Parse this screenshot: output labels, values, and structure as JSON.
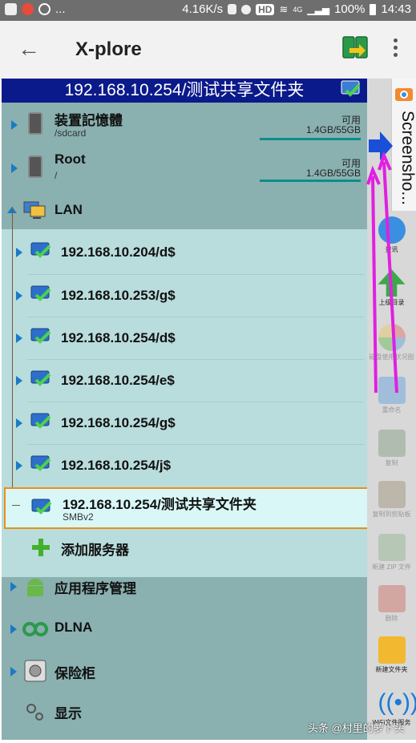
{
  "status_bar": {
    "left_text": "...",
    "speed": "4.16K/s",
    "hd": "HD",
    "network": "4G",
    "battery": "100%",
    "time": "14:43"
  },
  "app": {
    "title": "X-plore"
  },
  "path_bar": {
    "path": "192.168.10.254/测试共享文件夹"
  },
  "storage": [
    {
      "name": "装置記憶體",
      "sub": "/sdcard",
      "free_label": "可用",
      "size": "1.4GB/55GB",
      "used_fraction": 0.97
    },
    {
      "name": "Root",
      "sub": "/",
      "free_label": "可用",
      "size": "1.4GB/55GB",
      "used_fraction": 0.97
    }
  ],
  "lan": {
    "label": "LAN",
    "shares": [
      "192.168.10.204/d$",
      "192.168.10.253/g$",
      "192.168.10.254/d$",
      "192.168.10.254/e$",
      "192.168.10.254/g$",
      "192.168.10.254/j$"
    ],
    "selected": {
      "name": "192.168.10.254/测试共享文件夹",
      "sub": "SMBv2"
    },
    "add_server": "添加服务器"
  },
  "sections": [
    {
      "label": "应用程序管理",
      "icon": "android-icon"
    },
    {
      "label": "DLNA",
      "icon": "dlna-icon"
    },
    {
      "label": "保险柜",
      "icon": "vault-icon"
    },
    {
      "label": "显示",
      "icon": "display-settings-icon"
    }
  ],
  "screenshot_tab": "Screensho...",
  "toolbar": [
    {
      "label": "资讯",
      "icon": "info-icon",
      "enabled": true
    },
    {
      "label": "上级目录",
      "icon": "parent-folder-icon",
      "enabled": true
    },
    {
      "label": "磁盘使用状况图",
      "icon": "disk-usage-icon",
      "enabled": false
    },
    {
      "label": "重命名",
      "icon": "rename-icon",
      "enabled": false
    },
    {
      "label": "复制",
      "icon": "copy-icon",
      "enabled": false
    },
    {
      "label": "复制到剪贴板",
      "icon": "clipboard-icon",
      "enabled": false
    },
    {
      "label": "新建 ZIP 文件",
      "icon": "zip-icon",
      "enabled": false
    },
    {
      "label": "删除",
      "icon": "delete-icon",
      "enabled": false
    },
    {
      "label": "新建文件夹",
      "icon": "new-folder-icon",
      "enabled": true
    },
    {
      "label": "WiFi文件服务",
      "icon": "wifi-icon",
      "enabled": true
    }
  ],
  "watermark": "头条 @村里的萝卜头",
  "colors": {
    "path_bar": "#0b1a8a",
    "lan_bg": "#b9dcdc",
    "selected_border": "#e8911c",
    "accent_bar": "#0a8f8a"
  }
}
